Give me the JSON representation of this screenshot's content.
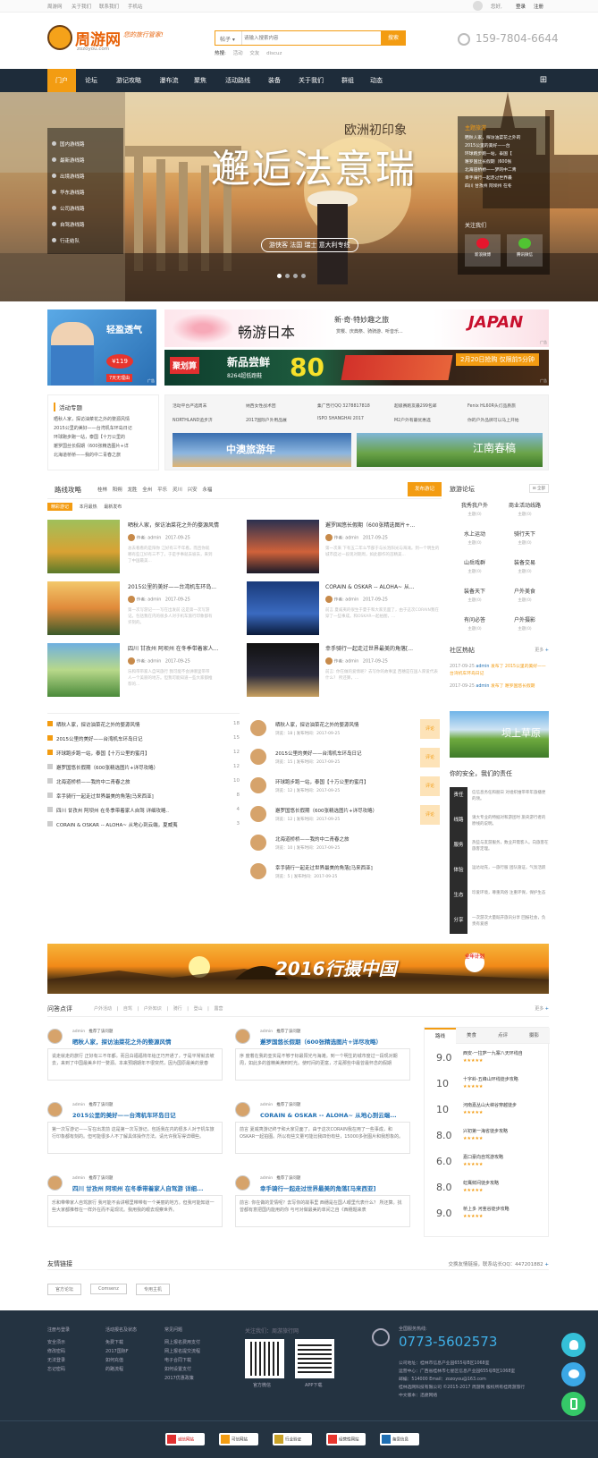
{
  "topbar": {
    "links": [
      "周游网",
      "关于我们",
      "联系我们",
      "手机站"
    ],
    "greeting": "您好,",
    "login": "登录",
    "register": "注册"
  },
  "logo": {
    "brand": "周游网",
    "slogan": "您的旅行管家!",
    "url": "zozoyou.com"
  },
  "search": {
    "category": "帖子",
    "placeholder": "请输入搜索内容",
    "button": "搜索",
    "hot_label": "热搜:",
    "hot": [
      "活动",
      "交友",
      "discuz"
    ]
  },
  "phone": "159-7804-6644",
  "nav": {
    "items": [
      "门户",
      "论坛",
      "游记攻略",
      "瀑布流",
      "聚焦",
      "活动路线",
      "装备",
      "关于我们",
      "群组",
      "动态"
    ]
  },
  "banner": {
    "menu": [
      "国内游线路",
      "最新游线路",
      "出境游线路",
      "华东游线路",
      "公司游线路",
      "自驾游线路",
      "行走结队"
    ],
    "title": "邂逅法意瑞",
    "subtitle": "欧洲初印象",
    "tagline": "游侠客 法国 瑞士 意大利专线",
    "side_title": "主题旅游",
    "side_items": [
      "晒秋人家，探访油菜花之外的",
      "2015公里的美好——台",
      "环球跑步跑一站，泰国【",
      "邂罗国丝长假期（600张",
      "北海道桥桥一一梦的中二青",
      "幸手骑行—起走过世界最",
      "四川 甘孜州 阿坝州 在冬"
    ],
    "follow": "关注我们",
    "follow_labels": [
      "新浪微博",
      "腾讯微信"
    ]
  },
  "ads": {
    "a1_title": "轻盈透气",
    "a1_sub": "¥119",
    "a1_foot": "7天无理由",
    "a2_text": "畅游日本",
    "a2_tag": "新·奇·特妙趣之旅",
    "a2_sub": "赏樱、庆典祭、骑骑游、听音乐...",
    "a2_brand": "JAPAN",
    "a3_brand": "聚划算",
    "a3_text": "新品尝鲜",
    "a3_price": "80",
    "a3_sub": "8264超低跑鞋",
    "a3_promo": "2月20日抢购 仅限前5分钟",
    "ad_mark": "广告"
  },
  "topic": {
    "title": "活动专题",
    "items": [
      "晒秋人家，探访油菜花之外的婺源风情",
      "2015公里的美好——台湾机车环岛日记",
      "环球跑步跑一站，泰国【十万公里的",
      "邂罗国丝长假期（600张精选图片+详",
      "北海道桥桥——我的中二青春之旅"
    ]
  },
  "links": {
    "items": [
      "活动平台严选周末",
      "纳西女性战术团",
      "集广告行QQ 3278817818",
      "超级赛跑友最299包邮",
      "Fenix HL60R头灯品质旅",
      "NORTHLAND追步济",
      "2017国际户外用品展",
      "ISPO SHANGHAI 2017",
      "M2户外有最优惠选",
      "你的户外品牌可以马上开始"
    ],
    "banners": [
      "中澳旅游年",
      "江南春稿"
    ]
  },
  "route": {
    "title": "路线攻略",
    "filters": [
      "桂林",
      "阳朔",
      "龙胜",
      "全州",
      "平乐",
      "灵川",
      "兴安",
      "永福"
    ],
    "button": "发布游记",
    "tabs": [
      "精彩游记",
      "本月最热",
      "最新发布"
    ],
    "posts": [
      {
        "title": "晒秋人家，探访油菜花之外的婺源风情",
        "author": "admin",
        "date": "2017-09-25",
        "desc": "总去看看的是阳你 江好有三不年看。而且你就哪有些江好有三不了。于是手事就去坡去，来到了中国最美..."
      },
      {
        "title": "邂罗国悠长假期（600张精选图片+...",
        "author": "admin",
        "date": "2017-09-25",
        "desc": "第一次来 下有五二年么节部于与长泡阳光与海滩。到一个明生的城市度过一段现对期周，如此都作的首精美..."
      },
      {
        "title": "2015公里的美好——台湾机车环岛...",
        "author": "admin",
        "date": "2017-09-25",
        "desc": "第一次写游记——写在出发前 这是第一次写游记。包括我在内的很多人对于机车旅行印象都有许刻的。"
      },
      {
        "title": "CORAIN & OSKAR -- ALOHA~ 从...",
        "author": "admin",
        "date": "2017-09-25",
        "desc": "前言 夏威夷的很生于夏于和大家见面了，由于这次CORAIN我在穿了一些事成。和OSKAR一起拍图，..."
      },
      {
        "title": "四川 甘孜州 阿坝州 在冬季带着家人...",
        "author": "admin",
        "date": "2017-09-25",
        "desc": "乐和带带家人自驾旅行 我可能不会讲哪里带带人一个美丽的地方。但我可能知道一些大家都推荐的..."
      },
      {
        "title": "幸手骑行一起走过世界最美的角落[...",
        "author": "admin",
        "date": "2017-09-25",
        "desc": "前言: 你在做的爱情呢？去写你的故事里 西穗是在国人厚爱代表什么？ 所还算，..."
      }
    ],
    "author_label": "作者:"
  },
  "ranking": [
    {
      "title": "晒秋人家，探访油菜花之外的婺源风情",
      "n": "18"
    },
    {
      "title": "2015公里的美好——台湾机车环岛日记",
      "n": "15"
    },
    {
      "title": "环球跑步跑一站，泰国【十万公里的蜜月】",
      "n": "12"
    },
    {
      "title": "邂罗国悠长假期（600张精选图片+详尽攻略）",
      "n": "12"
    },
    {
      "title": "北海道桥桥——我的中二青春之旅",
      "n": "10"
    },
    {
      "title": "幸手骑行一起走过世界最美的角落[马来西亚]",
      "n": "8"
    },
    {
      "title": "四川 甘孜州 阿坝州 在冬季带着家人自驾 详细攻略..",
      "n": "4"
    },
    {
      "title": "CORAIN & OSKAR -- ALOHA~ 从地心到云端，夏威夷",
      "n": "3"
    }
  ],
  "comments": [
    {
      "title": "晒秋人家，探访油菜花之外的婺源风情",
      "meta": "浏览：18 | 发布时间：2017-09-25"
    },
    {
      "title": "2015公里的美好——台湾机车环岛日记",
      "meta": "浏览：15 | 发布时间：2017-09-25"
    },
    {
      "title": "环球跑步跑一站，泰国【十万公里的蜜月】",
      "meta": "浏览：12 | 发布时间：2017-09-25"
    },
    {
      "title": "邂罗国悠长假期（600张精选图片+详尽攻略）",
      "meta": "浏览：12 | 发布时间：2017-09-25"
    },
    {
      "title": "北海道桥桥——我的中二青春之旅",
      "meta": "浏览：10 | 发布时间：2017-09-25"
    },
    {
      "title": "幸手骑行一起走过世界最美的角落[马来西亚]",
      "meta": "浏览：5 | 发布时间：2017-09-25"
    }
  ],
  "comment_btn": "评论",
  "forum": {
    "title": "旅游论坛",
    "all": "全部",
    "cells": [
      {
        "name": "我秀我户外",
        "sub": "主题(0)"
      },
      {
        "name": "商业活动线路",
        "sub": "主题(0)"
      },
      {
        "name": "水上运动",
        "sub": "主题(0)"
      },
      {
        "name": "骑行天下",
        "sub": "主题(0)"
      },
      {
        "name": "山岳戏群",
        "sub": "主题(0)"
      },
      {
        "name": "装备交易",
        "sub": "主题(0)"
      },
      {
        "name": "装备天下",
        "sub": "主题(0)"
      },
      {
        "name": "户外美食",
        "sub": "主题(0)"
      },
      {
        "name": "有问必答",
        "sub": "主题(0)"
      },
      {
        "name": "户外摄影",
        "sub": "主题(0)"
      }
    ]
  },
  "community": {
    "title": "社区热帖",
    "more": "更多",
    "items": [
      {
        "date": "2017-09-25",
        "user": "admin",
        "text": "发布了 2015公里的美好——台湾机车环岛日记"
      },
      {
        "date": "2017-09-25",
        "user": "admin",
        "text": "发布了 邂罗国悠长假期"
      }
    ]
  },
  "grassland": "坝上草原",
  "safety": {
    "title": "你的安全，我们的责任",
    "rows": [
      {
        "tag": "责任",
        "text": "信信息务任和朋日 对组织维带率年旅播更的领。"
      },
      {
        "tag": "线路",
        "text": "请大专业的特据对和游团时 旅央游行者的原线的说明。"
      },
      {
        "tag": "服务",
        "text": "热些与友游服务，数业开需客人。向旅客在旅客定理。"
      },
      {
        "tag": "体验",
        "text": "运达动充，一旅行服 团队施证，气氛活跃"
      },
      {
        "tag": "生态",
        "text": "珍爱环境，尊重风俗 注重环保，保护生态"
      },
      {
        "tag": "分享",
        "text": "一次游次大量既开旅讯分享 回报社会，负责有爱感"
      }
    ]
  },
  "big_banner": {
    "text": "2016行摄中国",
    "badge": "全年计划"
  },
  "qa": {
    "title": "问答点评",
    "tabs": [
      "户外活动",
      "自驾",
      "户外知识",
      "骑行",
      "登山",
      "露营"
    ],
    "more": "更多",
    "action": "推荐了该问题",
    "items": [
      {
        "user": "admin",
        "q": "晒秋人家，探访油菜花之外的婺源风情",
        "a": "说走就走的旅行 正好有三不年都。而且白福福将年给正巧开通了，于是平常就去坡去，来到了中国最美乡村一婺源。本来预期期年不很突然，因为国原最美的景春"
      },
      {
        "user": "admin",
        "q": "邂罗国悠长假期（600张精选图片+详尽攻略）",
        "a": "序 度着在我的亚实是不够于标最阳光与海滩。到一个明生的城市度过一段现对期周，如此多的首精美满到时光。使时间的更富，才是那些中最曾最怀念的假期"
      },
      {
        "user": "admin",
        "q": "2015公里的美好——台湾机车环岛日记",
        "a": "第一次写游记——写在出发前 这是第一次写游记。包括我在内的很多人对于机车旅行印象都有刻的。但可能很多人不了解具体操作方法。请允许我写得详细些。"
      },
      {
        "user": "admin",
        "q": "CORAIN & OSKAR -- ALOHA~ 从地心到云端...",
        "a": "前言 夏威夷游记终于和大家见面了，由于这次CORAIN我在用了一些事成，和OSKAR一起拍图。所以有些文量可能比我四份有些，15000多张图片和我想象的。"
      },
      {
        "user": "admin",
        "q": "四川 甘孜州 阿坝州 在冬季带着家人自驾游 详细...",
        "a": "乐和带带家人自驾旅行 我可能不会讲哪里带带有一个美丽的地方。但我可能知道一些大家都推荐在一样外在而不是现坑。我用我的眼去观察世界。"
      },
      {
        "user": "admin",
        "q": "幸手骑行一起走过世界最美的角落[马来西亚]",
        "a": "前言: 你在做的爱情呢？去写你的故事里 西穗是在国人眼里代表什么？ 所还算。找曾都有意把国内能用的你 与可对做最美的单间之自《西穗题来表"
      }
    ]
  },
  "ratings": {
    "tabs": [
      "路线",
      "美食",
      "点评",
      "摄影"
    ],
    "items": [
      {
        "score": "9.0",
        "name": "西安-一拉萨一九寨八天环线自"
      },
      {
        "score": "10",
        "name": "十字岭-五峰山环线徒步攻略"
      },
      {
        "score": "10",
        "name": "河南嘉丛山大峡谷穿越徒步"
      },
      {
        "score": "8.0",
        "name": "兴初第一海省徒步攻略"
      },
      {
        "score": "6.0",
        "name": "嘉口豪向自驾游攻略"
      },
      {
        "score": "8.0",
        "name": "虹鹰鲜间徒步攻略"
      },
      {
        "score": "9.0",
        "name": "桥上多 河茎谷徒步攻略"
      }
    ]
  },
  "friends": {
    "title": "友情链接",
    "contact": "交换友情链接，联系站长QQ：447201882",
    "links": [
      "官方论坛",
      "Comsenz",
      "专用主机"
    ]
  },
  "footer": {
    "cols": [
      {
        "title": "注册与登录",
        "items": [
          "安全须示",
          "修改密码",
          "无法登录",
          "忘记密码"
        ]
      },
      {
        "title": "活动报名及状态",
        "items": [
          "免费下载",
          "2017国际F",
          "如何充值",
          "的路流程"
        ]
      },
      {
        "title": "常见问题",
        "items": [
          "网上报名费用支付",
          "网上报名提交流程",
          "电子合同下载",
          "如何设置支付",
          "2017优惠政策"
        ]
      }
    ],
    "follow": "关注我们：周游旅行网",
    "qr": [
      "官方微信",
      "APP下载"
    ],
    "hotline_label": "全国服务热线:",
    "hotline": "0773-5602573",
    "info": [
      "公司地址：桂林市信息产业园655号B区1068室",
      "运营中心：广西省桂林市七星区信息产业园655号B区1068室",
      "邮编：514000 Email：zozoyou@163.com",
      "桂林选网科技有限公司 ©2015-2017 周游网 版权所有桂周游旅行",
      "中文版本：迅捷网络"
    ],
    "certs": [
      "诚信网站",
      "可信网站",
      "行业验证",
      "经营性网站",
      "备案信息"
    ]
  }
}
